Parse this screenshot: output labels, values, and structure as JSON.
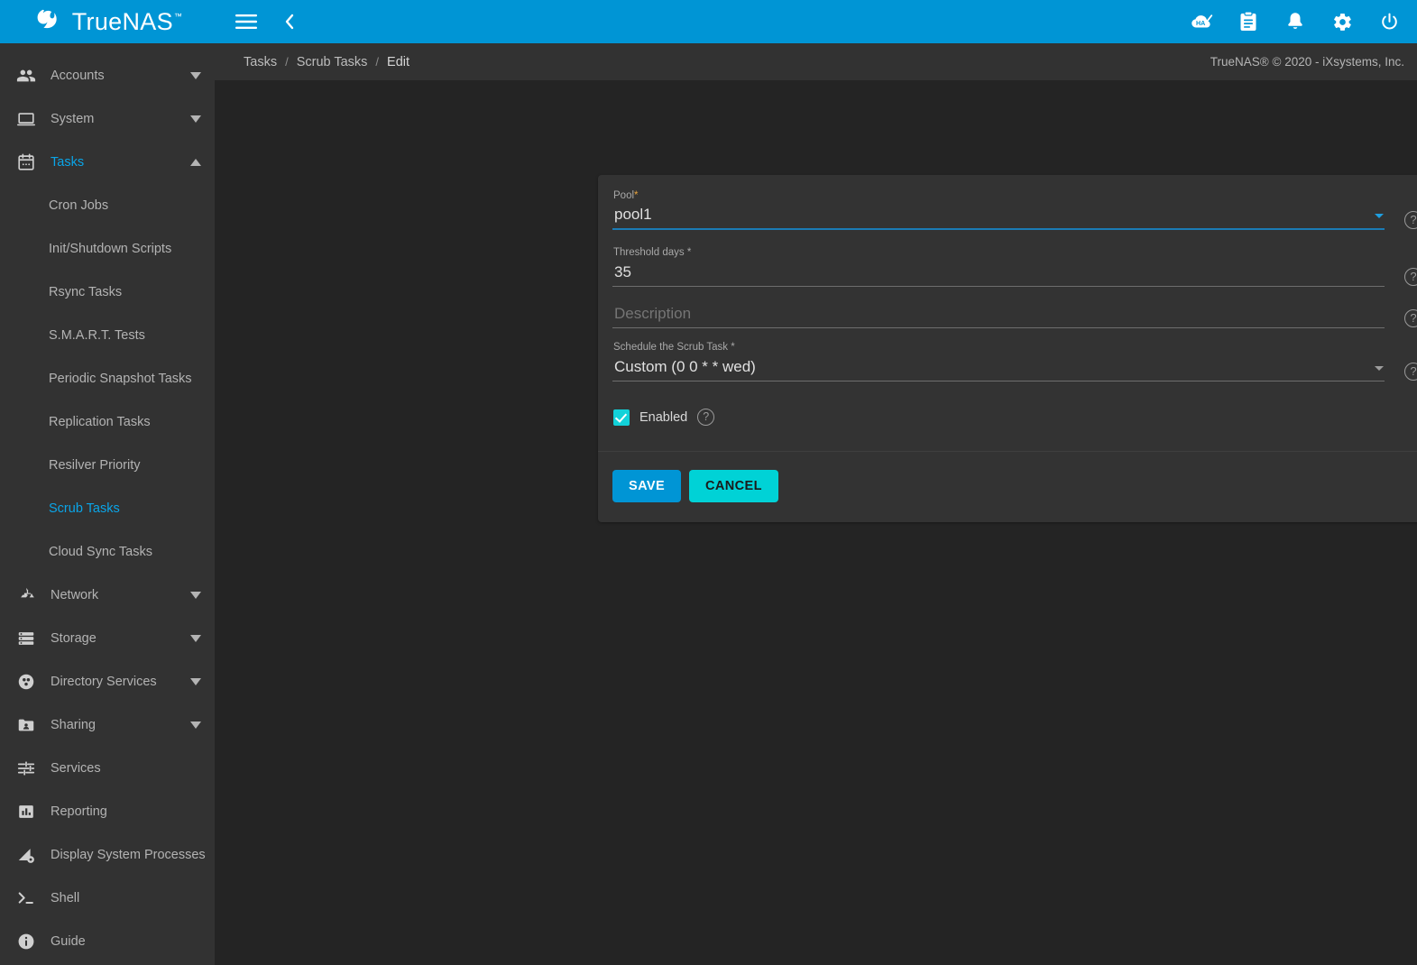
{
  "brand": {
    "name": "TrueNAS",
    "logo_icon": "truenas-logo-icon",
    "accent": "#0095d5"
  },
  "topbar": {
    "menu_icon": "hamburger-menu-icon",
    "back_icon": "chevron-left-icon",
    "actions": [
      {
        "icon": "ha-cloud-status-icon",
        "label": "HA"
      },
      {
        "icon": "clipboard-tasks-icon",
        "label": "Jobs"
      },
      {
        "icon": "bell-notifications-icon",
        "label": "Alerts"
      },
      {
        "icon": "gear-settings-icon",
        "label": "Settings"
      },
      {
        "icon": "power-icon",
        "label": "Power"
      }
    ]
  },
  "breadcrumb": {
    "items": [
      "Tasks",
      "Scrub Tasks",
      "Edit"
    ],
    "separator": "/",
    "copyright": "TrueNAS® © 2020 - iXsystems, Inc."
  },
  "sidebar": {
    "items": [
      {
        "label": "Accounts",
        "icon": "accounts-people-icon",
        "expandable": true,
        "expanded": false,
        "active": false
      },
      {
        "label": "System",
        "icon": "system-laptop-icon",
        "expandable": true,
        "expanded": false,
        "active": false
      },
      {
        "label": "Tasks",
        "icon": "tasks-calendar-icon",
        "expandable": true,
        "expanded": true,
        "active": true
      },
      {
        "label": "Network",
        "icon": "network-nodes-icon",
        "expandable": true,
        "expanded": false,
        "active": false
      },
      {
        "label": "Storage",
        "icon": "storage-disks-icon",
        "expandable": true,
        "expanded": false,
        "active": false
      },
      {
        "label": "Directory Services",
        "icon": "directory-services-icon",
        "expandable": true,
        "expanded": false,
        "active": false
      },
      {
        "label": "Sharing",
        "icon": "sharing-folder-icon",
        "expandable": true,
        "expanded": false,
        "active": false
      },
      {
        "label": "Services",
        "icon": "services-sliders-icon",
        "expandable": false,
        "expanded": false,
        "active": false
      },
      {
        "label": "Reporting",
        "icon": "reporting-chart-icon",
        "expandable": false,
        "expanded": false,
        "active": false
      },
      {
        "label": "Display System Processes",
        "icon": "system-processes-icon",
        "expandable": false,
        "expanded": false,
        "active": false
      },
      {
        "label": "Shell",
        "icon": "shell-terminal-icon",
        "expandable": false,
        "expanded": false,
        "active": false
      },
      {
        "label": "Guide",
        "icon": "guide-info-icon",
        "expandable": false,
        "expanded": false,
        "active": false
      }
    ],
    "tasks_submenu": [
      {
        "label": "Cron Jobs",
        "active": false
      },
      {
        "label": "Init/Shutdown Scripts",
        "active": false
      },
      {
        "label": "Rsync Tasks",
        "active": false
      },
      {
        "label": "S.M.A.R.T. Tests",
        "active": false
      },
      {
        "label": "Periodic Snapshot Tasks",
        "active": false
      },
      {
        "label": "Replication Tasks",
        "active": false
      },
      {
        "label": "Resilver Priority",
        "active": false
      },
      {
        "label": "Scrub Tasks",
        "active": true
      },
      {
        "label": "Cloud Sync Tasks",
        "active": false
      }
    ],
    "active_color": "#0aa5e8"
  },
  "form": {
    "fields": {
      "pool": {
        "label": "Pool",
        "required_mark": "*",
        "value": "pool1",
        "type": "select",
        "focused": true,
        "help_icon": "help-question-icon"
      },
      "threshold_days": {
        "label": "Threshold days",
        "required_mark": "*",
        "value": "35",
        "type": "text",
        "focused": false,
        "help_icon": "help-question-icon"
      },
      "description": {
        "label": "",
        "placeholder": "Description",
        "value": "",
        "type": "text",
        "focused": false,
        "help_icon": "help-question-icon"
      },
      "schedule": {
        "label": "Schedule the Scrub Task",
        "required_mark": "*",
        "value": "Custom (0 0 * * wed)",
        "type": "select",
        "focused": false,
        "help_icon": "help-question-icon"
      },
      "enabled": {
        "label": "Enabled",
        "checked": true,
        "help_icon": "help-question-icon"
      }
    },
    "buttons": {
      "save": "SAVE",
      "cancel": "CANCEL"
    },
    "colors": {
      "save_bg": "#0095d5",
      "cancel_bg": "#00d2d6",
      "checkbox": "#12d2d9",
      "focus_underline": "#1b7bb5",
      "required_amber": "#e8a33d"
    }
  }
}
